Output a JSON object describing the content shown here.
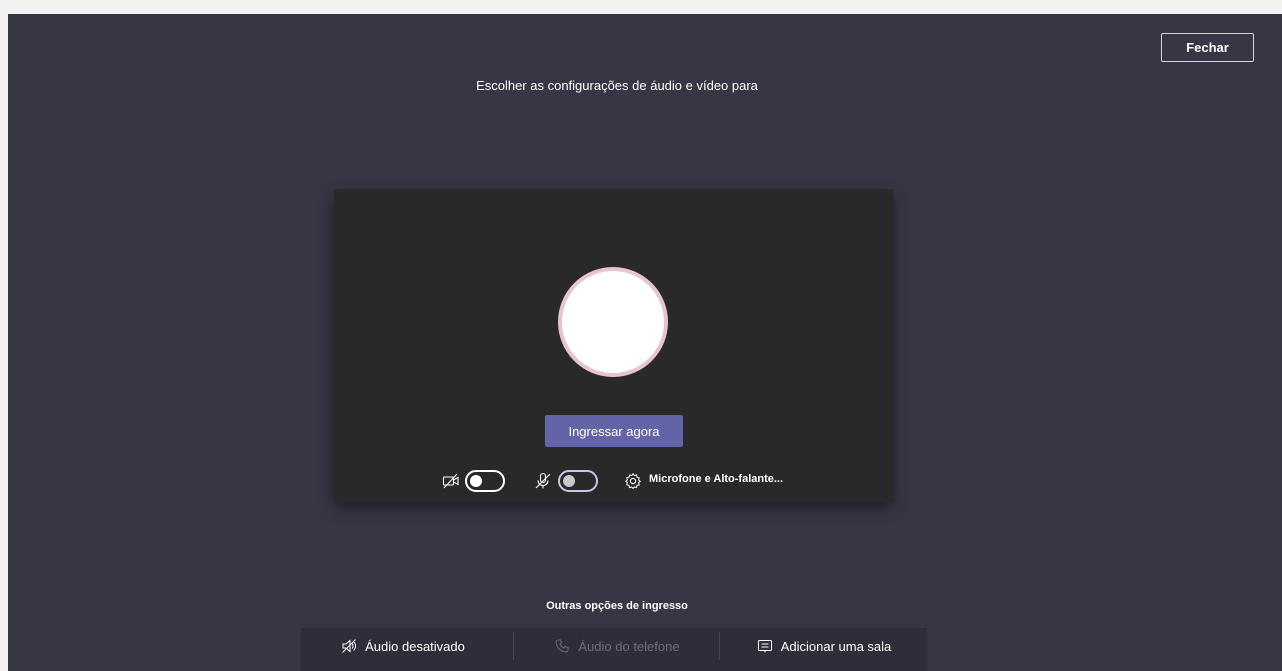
{
  "header": {
    "close_label": "Fechar",
    "title": "Escolher as configurações de áudio e vídeo para"
  },
  "preview": {
    "join_label": "Ingressar agora",
    "camera_on": false,
    "mic_on": false,
    "device_settings_label": "Microfone e Alto-falante..."
  },
  "other_options": {
    "title": "Outras opções de ingresso",
    "items": [
      {
        "label": "Áudio desativado",
        "icon": "speaker-off-icon",
        "enabled": true
      },
      {
        "label": "Áudio do telefone",
        "icon": "phone-icon",
        "enabled": false
      },
      {
        "label": "Adicionar uma sala",
        "icon": "room-icon",
        "enabled": true
      }
    ]
  },
  "colors": {
    "background": "#373645",
    "preview_bg": "#292929",
    "accent": "#6264a7",
    "avatar_ring": "#e8c4d0"
  }
}
